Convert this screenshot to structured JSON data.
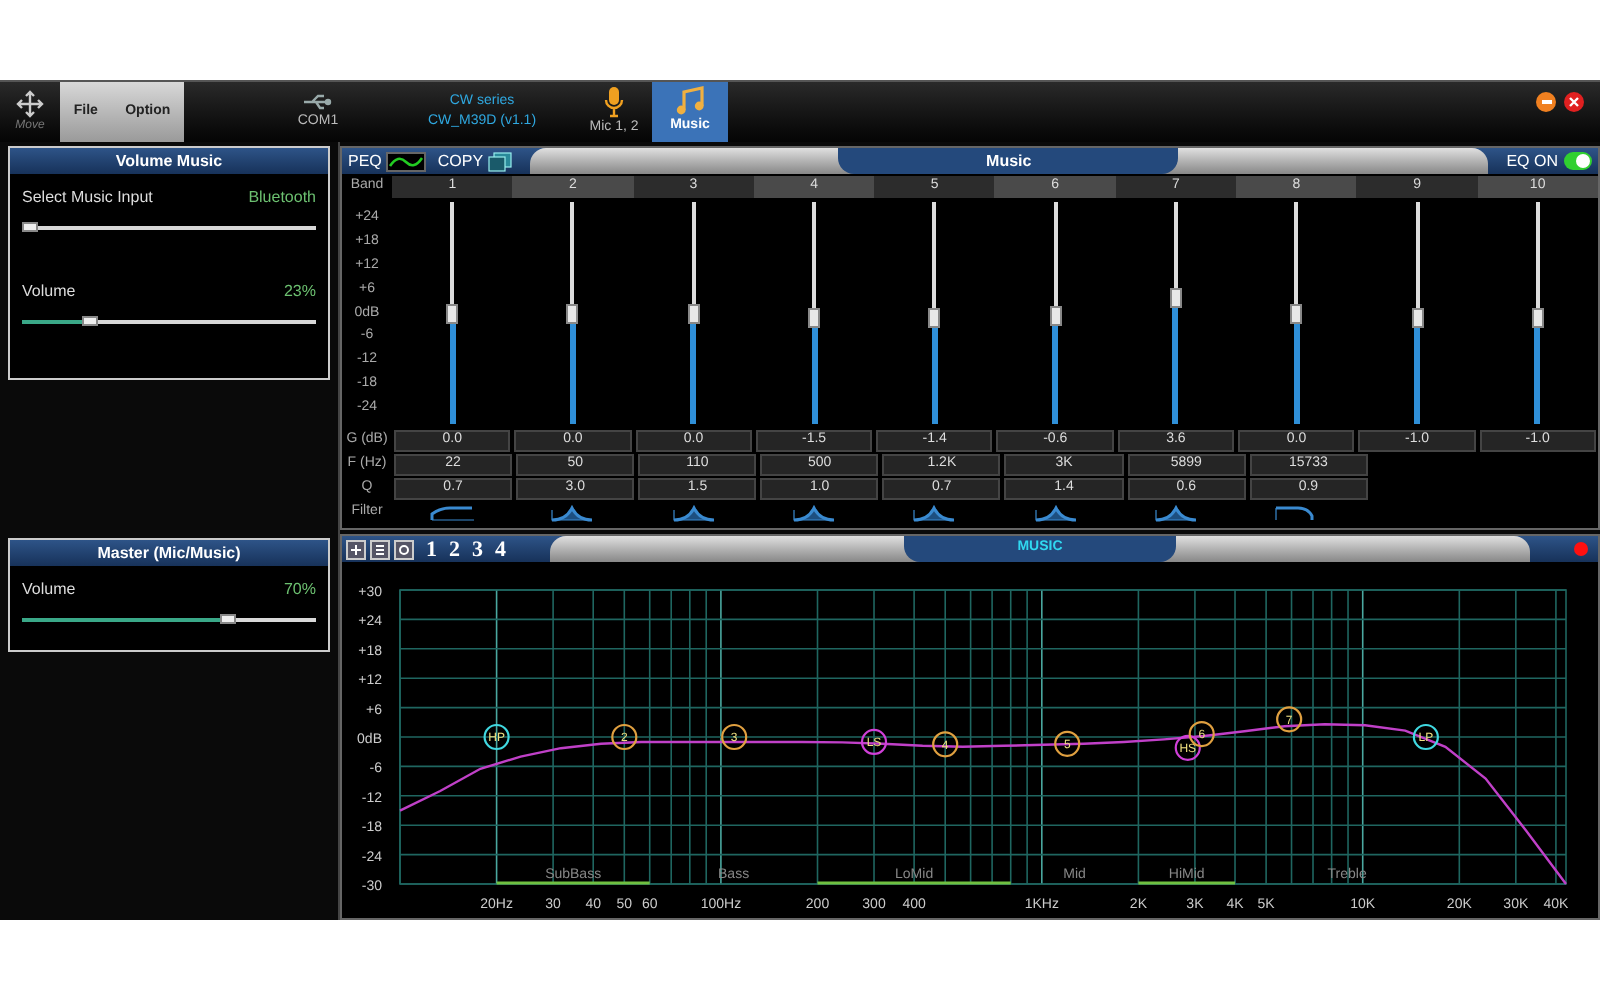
{
  "toolbar": {
    "move_label": "Move",
    "menu": [
      "File",
      "Option"
    ],
    "tabs": [
      {
        "kind": "port",
        "label": "COM1",
        "selected": false
      },
      {
        "kind": "device",
        "label": "CW series",
        "sublabel": "CW_M39D (v1.1)",
        "selected": false
      },
      {
        "kind": "mic",
        "label": "Mic 1, 2",
        "selected": false
      },
      {
        "kind": "music",
        "label": "Music",
        "selected": true
      }
    ]
  },
  "volume_music": {
    "title": "Volume Music",
    "sliders": [
      {
        "kind": "selector",
        "label": "Select Music Input",
        "value": "Bluetooth",
        "level": 0.03
      },
      {
        "kind": "volume",
        "label": "Volume",
        "value": "23%",
        "level": 0.23
      }
    ]
  },
  "master": {
    "title": "Master (Mic/Music)",
    "sliders": [
      {
        "kind": "volume",
        "label": "Volume",
        "value": "70%",
        "level": 0.7
      }
    ]
  },
  "peq": {
    "peq_label": "PEQ",
    "copy_label": "COPY",
    "title": "Music",
    "eq_label": "EQ ON",
    "eq_on": true,
    "row_labels": {
      "band": "Band",
      "gain": "G (dB)",
      "freq": "F (Hz)",
      "q": "Q",
      "filter": "Filter"
    },
    "scale": [
      "+24",
      "+18",
      "+12",
      "+6",
      "0dB",
      "-6",
      "-12",
      "-18",
      "-24"
    ],
    "bands": [
      {
        "label": "1",
        "level": 0.5,
        "gain": "0.0",
        "freq": "22",
        "q": "0.7",
        "kind": "highpass"
      },
      {
        "label": "2",
        "level": 0.5,
        "gain": "0.0",
        "freq": "50",
        "q": "3.0",
        "kind": "peak"
      },
      {
        "label": "3",
        "level": 0.5,
        "gain": "0.0",
        "freq": "110",
        "q": "1.5",
        "kind": "peak"
      },
      {
        "label": "4",
        "level": 0.48,
        "gain": "-1.5",
        "freq": "500",
        "q": "1.0",
        "kind": "peak"
      },
      {
        "label": "5",
        "level": 0.48,
        "gain": "-1.4",
        "freq": "1.2K",
        "q": "0.7",
        "kind": "peak"
      },
      {
        "label": "6",
        "level": 0.49,
        "gain": "-0.6",
        "freq": "3K",
        "q": "1.4",
        "kind": "peak"
      },
      {
        "label": "7",
        "level": 0.57,
        "gain": "3.6",
        "freq": "5899",
        "q": "0.6",
        "kind": "peak"
      },
      {
        "label": "8",
        "level": 0.5,
        "gain": "0.0",
        "freq": "15733",
        "q": "0.9",
        "kind": "lowpass"
      },
      {
        "label": "9",
        "level": 0.48,
        "gain": "-1.0"
      },
      {
        "label": "10",
        "level": 0.48,
        "gain": "-1.0"
      }
    ]
  },
  "graph": {
    "presets": [
      "1",
      "2",
      "3",
      "4"
    ],
    "title": "MUSIC",
    "chart_data": {
      "type": "line",
      "grid": true,
      "ylim": [
        -30,
        30
      ],
      "categories": [
        null,
        null,
        null,
        null,
        null,
        null,
        null,
        null,
        null,
        null,
        null,
        null,
        null,
        null,
        null,
        null,
        null,
        null,
        null,
        null,
        null,
        null,
        null,
        null,
        null,
        null,
        null,
        null,
        null,
        null
      ],
      "series": [
        {
          "color": "#c040c8",
          "values": [
            -15,
            -11,
            -6.5,
            -4,
            -2.3,
            -1.4,
            -1,
            -1,
            -1,
            -1,
            -1,
            -1.1,
            -1.4,
            -1.8,
            -2,
            -1.8,
            -1.6,
            -1.4,
            -1,
            -0.5,
            0.2,
            1.2,
            2.2,
            2.6,
            2.4,
            1.3,
            -2,
            -8.5,
            -19,
            -30
          ]
        }
      ],
      "yticks": [
        {
          "value": 30,
          "label": "+30"
        },
        {
          "value": 24,
          "label": "+24"
        },
        {
          "value": 18,
          "label": "+18"
        },
        {
          "value": 12,
          "label": "+12"
        },
        {
          "value": 6,
          "label": "+6"
        },
        {
          "value": 0,
          "label": "0dB"
        },
        {
          "value": -6,
          "label": "-6"
        },
        {
          "value": -12,
          "label": "-12"
        },
        {
          "value": -18,
          "label": "-18"
        },
        {
          "value": -24,
          "label": "-24"
        },
        {
          "value": -30,
          "label": "-30"
        }
      ]
    },
    "x_labels": [
      "20Hz",
      "30",
      "40",
      "50",
      "60",
      "100Hz",
      "200",
      "300",
      "400",
      "1KHz",
      "2K",
      "3K",
      "4K",
      "5K",
      "10K",
      "20K",
      "30K",
      "40K"
    ],
    "zones": [
      {
        "label": "SubBass",
        "highlighted": true
      },
      {
        "label": "Bass",
        "highlighted": false
      },
      {
        "label": "LoMid",
        "highlighted": true
      },
      {
        "label": "Mid",
        "highlighted": false
      },
      {
        "label": "HiMid",
        "highlighted": true
      },
      {
        "label": "Treble",
        "highlighted": false
      }
    ],
    "markers": [
      {
        "label": "HP",
        "color": "#40d8e0"
      },
      {
        "label": "2",
        "color": "#e0a040"
      },
      {
        "label": "3",
        "color": "#e0a040"
      },
      {
        "label": "LS",
        "color": "#d040d8"
      },
      {
        "label": "4",
        "color": "#e0a040"
      },
      {
        "label": "5",
        "color": "#e0a040"
      },
      {
        "label": "HS",
        "color": "#d040d8"
      },
      {
        "label": "6",
        "color": "#e0a040"
      },
      {
        "label": "7",
        "color": "#e0a040"
      },
      {
        "label": "LP",
        "color": "#40d8e0"
      }
    ]
  }
}
